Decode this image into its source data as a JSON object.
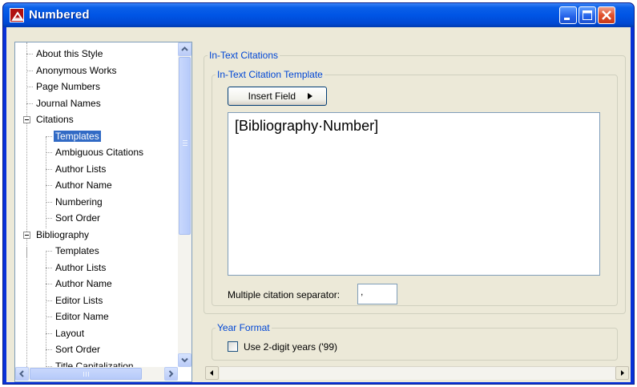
{
  "window": {
    "title": "Numbered"
  },
  "tree": {
    "items": [
      {
        "label": "About this Style",
        "level": 1,
        "selected": false
      },
      {
        "label": "Anonymous Works",
        "level": 1,
        "selected": false
      },
      {
        "label": "Page Numbers",
        "level": 1,
        "selected": false
      },
      {
        "label": "Journal Names",
        "level": 1,
        "selected": false
      },
      {
        "label": "Citations",
        "level": 1,
        "expander": true,
        "selected": false
      },
      {
        "label": "Templates",
        "level": 2,
        "selected": true
      },
      {
        "label": "Ambiguous Citations",
        "level": 2,
        "selected": false
      },
      {
        "label": "Author Lists",
        "level": 2,
        "selected": false
      },
      {
        "label": "Author Name",
        "level": 2,
        "selected": false
      },
      {
        "label": "Numbering",
        "level": 2,
        "selected": false
      },
      {
        "label": "Sort Order",
        "level": 2,
        "selected": false
      },
      {
        "label": "Bibliography",
        "level": 1,
        "expander": true,
        "selected": false
      },
      {
        "label": "Templates",
        "level": 2,
        "selected": false
      },
      {
        "label": "Author Lists",
        "level": 2,
        "selected": false
      },
      {
        "label": "Author Name",
        "level": 2,
        "selected": false
      },
      {
        "label": "Editor Lists",
        "level": 2,
        "selected": false
      },
      {
        "label": "Editor Name",
        "level": 2,
        "selected": false
      },
      {
        "label": "Layout",
        "level": 2,
        "selected": false
      },
      {
        "label": "Sort Order",
        "level": 2,
        "selected": false
      },
      {
        "label": "Title Capitalization",
        "level": 2,
        "selected": false
      }
    ]
  },
  "in_text": {
    "group_title": "In-Text Citations",
    "template_group_title": "In-Text Citation Template",
    "insert_field_label": "Insert Field",
    "template_text": "[Bibliography·Number]",
    "separator_label": "Multiple citation separator:",
    "separator_value": ","
  },
  "year_format": {
    "group_title": "Year Format",
    "checkbox_label": "Use 2-digit years ('99)",
    "checked": false
  },
  "colors": {
    "selection": "#316ac5",
    "group_title": "#0046d5",
    "titlebar": "#0055e5"
  }
}
